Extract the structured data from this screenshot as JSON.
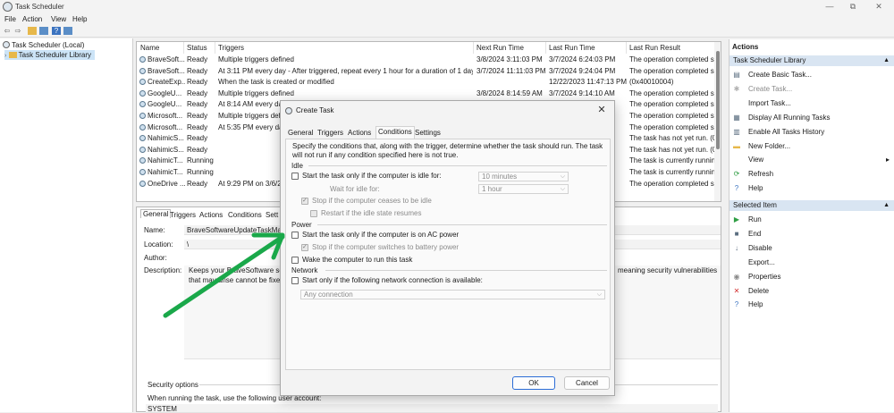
{
  "window": {
    "title": "Task Scheduler",
    "controls": {
      "minimize": "—",
      "maximize": "⧉",
      "close": "✕"
    }
  },
  "menu": [
    "File",
    "Action",
    "View",
    "Help"
  ],
  "tree": {
    "root": "Task Scheduler (Local)",
    "library": "Task Scheduler Library"
  },
  "tasklist": {
    "columns": [
      "Name",
      "Status",
      "Triggers",
      "Next Run Time",
      "Last Run Time",
      "Last Run Result"
    ],
    "rows": [
      [
        "BraveSoft...",
        "Ready",
        "Multiple triggers defined",
        "3/8/2024 3:11:03 PM",
        "3/7/2024 6:24:03 PM",
        "The operation completed su"
      ],
      [
        "BraveSoft...",
        "Ready",
        "At 3:11 PM every day - After triggered, repeat every 1 hour for a duration of 1 day.",
        "3/7/2024 11:11:03 PM",
        "3/7/2024 9:24:04 PM",
        "The operation completed su"
      ],
      [
        "CreateExp...",
        "Ready",
        "When the task is created or modified",
        "",
        "12/22/2023 11:47:13 PM",
        "(0x40010004)"
      ],
      [
        "GoogleU...",
        "Ready",
        "Multiple triggers defined",
        "3/8/2024 8:14:59 AM",
        "3/7/2024 9:14:10 AM",
        "The operation completed su"
      ],
      [
        "GoogleU...",
        "Ready",
        "At 8:14 AM every day",
        "",
        "",
        "The operation completed su"
      ],
      [
        "Microsoft...",
        "Ready",
        "Multiple triggers def",
        "",
        "",
        "The operation completed su"
      ],
      [
        "Microsoft...",
        "Ready",
        "At 5:35 PM every day",
        "",
        "",
        "The operation completed su"
      ],
      [
        "NahimicS...",
        "Ready",
        "",
        "",
        "AM",
        "The task has not yet run. (0x"
      ],
      [
        "NahimicS...",
        "Ready",
        "",
        "",
        "AM",
        "The task has not yet run. (0x"
      ],
      [
        "NahimicT...",
        "Running",
        "",
        "",
        "",
        "The task is currently running"
      ],
      [
        "NahimicT...",
        "Running",
        "",
        "",
        "",
        "The task is currently running"
      ],
      [
        "OneDrive ...",
        "Ready",
        "At 9:29 PM on 3/6/2",
        "",
        "",
        "The operation completed su"
      ]
    ]
  },
  "details": {
    "tabs": [
      "General",
      "Triggers",
      "Actions",
      "Conditions",
      "Sett"
    ],
    "name_label": "Name:",
    "name_value": "BraveSoftwareUpdateTaskMac",
    "location_label": "Location:",
    "location_value": "\\",
    "author_label": "Author:",
    "description_label": "Description:",
    "description_line1": "Keeps your BraveSoftware sof",
    "description_line1_tail": "meaning security vulnerabilities",
    "description_line2": "that may arise cannot be fixed",
    "security_label": "Security options",
    "security_text": "When running the task, use the following user account:",
    "security_account": "SYSTEM"
  },
  "actions": {
    "title": "Actions",
    "section1": "Task Scheduler Library",
    "section1_items": [
      {
        "label": "Create Basic Task...",
        "icon": "create-basic-task-icon",
        "glyph": "▤",
        "disabled": false
      },
      {
        "label": "Create Task...",
        "icon": "create-task-icon",
        "glyph": "✱",
        "disabled": true
      },
      {
        "label": "Import Task...",
        "icon": "",
        "glyph": "",
        "disabled": false
      },
      {
        "label": "Display All Running Tasks",
        "icon": "running-tasks-icon",
        "glyph": "▦",
        "disabled": false
      },
      {
        "label": "Enable All Tasks History",
        "icon": "history-icon",
        "glyph": "▥",
        "disabled": false
      },
      {
        "label": "New Folder...",
        "icon": "folder-icon",
        "glyph": "▬",
        "disabled": false
      },
      {
        "label": "View",
        "icon": "",
        "glyph": "",
        "disabled": false
      },
      {
        "label": "Refresh",
        "icon": "refresh-icon",
        "glyph": "⟳",
        "disabled": false
      },
      {
        "label": "Help",
        "icon": "help-icon",
        "glyph": "?",
        "disabled": false
      }
    ],
    "section2": "Selected Item",
    "section2_items": [
      {
        "label": "Run",
        "icon": "run-icon",
        "glyph": "▶",
        "disabled": false
      },
      {
        "label": "End",
        "icon": "end-icon",
        "glyph": "■",
        "disabled": false
      },
      {
        "label": "Disable",
        "icon": "disable-icon",
        "glyph": "↓",
        "disabled": false
      },
      {
        "label": "Export...",
        "icon": "",
        "glyph": "",
        "disabled": false
      },
      {
        "label": "Properties",
        "icon": "properties-icon",
        "glyph": "◉",
        "disabled": false
      },
      {
        "label": "Delete",
        "icon": "delete-icon",
        "glyph": "✕",
        "disabled": false
      },
      {
        "label": "Help",
        "icon": "help-icon",
        "glyph": "?",
        "disabled": false
      }
    ]
  },
  "dialog": {
    "title": "Create Task",
    "tabs": [
      "General",
      "Triggers",
      "Actions",
      "Conditions",
      "Settings"
    ],
    "intro": "Specify the conditions that, along with the trigger, determine whether the task should run.  The task will not run  if any condition specified here is not true.",
    "idle": {
      "group": "Idle",
      "start_if_idle": "Start the task only if the computer is idle for:",
      "idle_duration": "10 minutes",
      "wait_label": "Wait for idle for:",
      "wait_duration": "1 hour",
      "stop_if_ceases": "Stop if the computer ceases to be idle",
      "restart_if_resumes": "Restart if the idle state resumes"
    },
    "power": {
      "group": "Power",
      "ac_power": "Start the task only if the computer is on AC power",
      "battery": "Stop if the computer switches to battery power",
      "wake": "Wake the computer to run this task"
    },
    "network": {
      "group": "Network",
      "start_if_network": "Start only if the following network connection is available:",
      "connection": "Any connection"
    },
    "ok": "OK",
    "cancel": "Cancel"
  },
  "annotation_color": "#1aa84a"
}
